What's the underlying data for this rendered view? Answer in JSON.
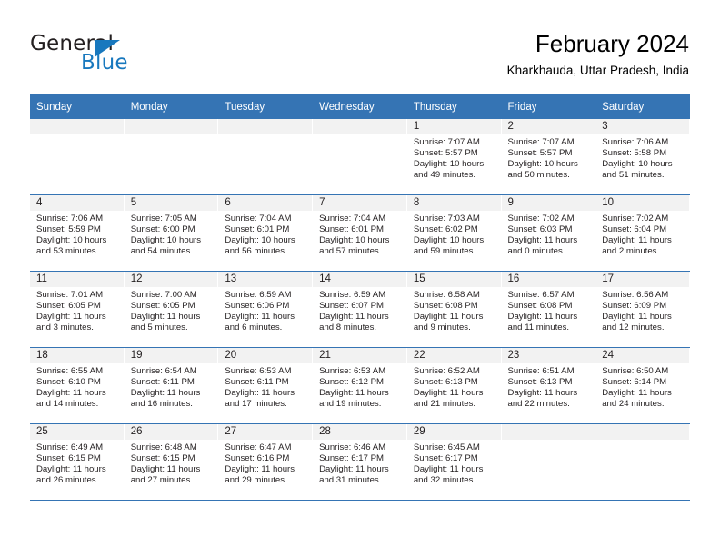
{
  "brand": {
    "name_part1": "General",
    "name_part2": "Blue",
    "logo_icon": "blue-triangle",
    "accent_color": "#1878be",
    "header_color": "#3574b4"
  },
  "header": {
    "title": "February 2024",
    "subtitle": "Kharkhauda, Uttar Pradesh, India"
  },
  "calendar": {
    "weekday_headers": [
      "Sunday",
      "Monday",
      "Tuesday",
      "Wednesday",
      "Thursday",
      "Friday",
      "Saturday"
    ],
    "labels": {
      "sunrise": "Sunrise:",
      "sunset": "Sunset:",
      "daylight": "Daylight:"
    },
    "weeks": [
      [
        {
          "day": ""
        },
        {
          "day": ""
        },
        {
          "day": ""
        },
        {
          "day": ""
        },
        {
          "day": "1",
          "sunrise": "Sunrise: 7:07 AM",
          "sunset": "Sunset: 5:57 PM",
          "daylight_line1": "Daylight: 10 hours",
          "daylight_line2": "and 49 minutes."
        },
        {
          "day": "2",
          "sunrise": "Sunrise: 7:07 AM",
          "sunset": "Sunset: 5:57 PM",
          "daylight_line1": "Daylight: 10 hours",
          "daylight_line2": "and 50 minutes."
        },
        {
          "day": "3",
          "sunrise": "Sunrise: 7:06 AM",
          "sunset": "Sunset: 5:58 PM",
          "daylight_line1": "Daylight: 10 hours",
          "daylight_line2": "and 51 minutes."
        }
      ],
      [
        {
          "day": "4",
          "sunrise": "Sunrise: 7:06 AM",
          "sunset": "Sunset: 5:59 PM",
          "daylight_line1": "Daylight: 10 hours",
          "daylight_line2": "and 53 minutes."
        },
        {
          "day": "5",
          "sunrise": "Sunrise: 7:05 AM",
          "sunset": "Sunset: 6:00 PM",
          "daylight_line1": "Daylight: 10 hours",
          "daylight_line2": "and 54 minutes."
        },
        {
          "day": "6",
          "sunrise": "Sunrise: 7:04 AM",
          "sunset": "Sunset: 6:01 PM",
          "daylight_line1": "Daylight: 10 hours",
          "daylight_line2": "and 56 minutes."
        },
        {
          "day": "7",
          "sunrise": "Sunrise: 7:04 AM",
          "sunset": "Sunset: 6:01 PM",
          "daylight_line1": "Daylight: 10 hours",
          "daylight_line2": "and 57 minutes."
        },
        {
          "day": "8",
          "sunrise": "Sunrise: 7:03 AM",
          "sunset": "Sunset: 6:02 PM",
          "daylight_line1": "Daylight: 10 hours",
          "daylight_line2": "and 59 minutes."
        },
        {
          "day": "9",
          "sunrise": "Sunrise: 7:02 AM",
          "sunset": "Sunset: 6:03 PM",
          "daylight_line1": "Daylight: 11 hours",
          "daylight_line2": "and 0 minutes."
        },
        {
          "day": "10",
          "sunrise": "Sunrise: 7:02 AM",
          "sunset": "Sunset: 6:04 PM",
          "daylight_line1": "Daylight: 11 hours",
          "daylight_line2": "and 2 minutes."
        }
      ],
      [
        {
          "day": "11",
          "sunrise": "Sunrise: 7:01 AM",
          "sunset": "Sunset: 6:05 PM",
          "daylight_line1": "Daylight: 11 hours",
          "daylight_line2": "and 3 minutes."
        },
        {
          "day": "12",
          "sunrise": "Sunrise: 7:00 AM",
          "sunset": "Sunset: 6:05 PM",
          "daylight_line1": "Daylight: 11 hours",
          "daylight_line2": "and 5 minutes."
        },
        {
          "day": "13",
          "sunrise": "Sunrise: 6:59 AM",
          "sunset": "Sunset: 6:06 PM",
          "daylight_line1": "Daylight: 11 hours",
          "daylight_line2": "and 6 minutes."
        },
        {
          "day": "14",
          "sunrise": "Sunrise: 6:59 AM",
          "sunset": "Sunset: 6:07 PM",
          "daylight_line1": "Daylight: 11 hours",
          "daylight_line2": "and 8 minutes."
        },
        {
          "day": "15",
          "sunrise": "Sunrise: 6:58 AM",
          "sunset": "Sunset: 6:08 PM",
          "daylight_line1": "Daylight: 11 hours",
          "daylight_line2": "and 9 minutes."
        },
        {
          "day": "16",
          "sunrise": "Sunrise: 6:57 AM",
          "sunset": "Sunset: 6:08 PM",
          "daylight_line1": "Daylight: 11 hours",
          "daylight_line2": "and 11 minutes."
        },
        {
          "day": "17",
          "sunrise": "Sunrise: 6:56 AM",
          "sunset": "Sunset: 6:09 PM",
          "daylight_line1": "Daylight: 11 hours",
          "daylight_line2": "and 12 minutes."
        }
      ],
      [
        {
          "day": "18",
          "sunrise": "Sunrise: 6:55 AM",
          "sunset": "Sunset: 6:10 PM",
          "daylight_line1": "Daylight: 11 hours",
          "daylight_line2": "and 14 minutes."
        },
        {
          "day": "19",
          "sunrise": "Sunrise: 6:54 AM",
          "sunset": "Sunset: 6:11 PM",
          "daylight_line1": "Daylight: 11 hours",
          "daylight_line2": "and 16 minutes."
        },
        {
          "day": "20",
          "sunrise": "Sunrise: 6:53 AM",
          "sunset": "Sunset: 6:11 PM",
          "daylight_line1": "Daylight: 11 hours",
          "daylight_line2": "and 17 minutes."
        },
        {
          "day": "21",
          "sunrise": "Sunrise: 6:53 AM",
          "sunset": "Sunset: 6:12 PM",
          "daylight_line1": "Daylight: 11 hours",
          "daylight_line2": "and 19 minutes."
        },
        {
          "day": "22",
          "sunrise": "Sunrise: 6:52 AM",
          "sunset": "Sunset: 6:13 PM",
          "daylight_line1": "Daylight: 11 hours",
          "daylight_line2": "and 21 minutes."
        },
        {
          "day": "23",
          "sunrise": "Sunrise: 6:51 AM",
          "sunset": "Sunset: 6:13 PM",
          "daylight_line1": "Daylight: 11 hours",
          "daylight_line2": "and 22 minutes."
        },
        {
          "day": "24",
          "sunrise": "Sunrise: 6:50 AM",
          "sunset": "Sunset: 6:14 PM",
          "daylight_line1": "Daylight: 11 hours",
          "daylight_line2": "and 24 minutes."
        }
      ],
      [
        {
          "day": "25",
          "sunrise": "Sunrise: 6:49 AM",
          "sunset": "Sunset: 6:15 PM",
          "daylight_line1": "Daylight: 11 hours",
          "daylight_line2": "and 26 minutes."
        },
        {
          "day": "26",
          "sunrise": "Sunrise: 6:48 AM",
          "sunset": "Sunset: 6:15 PM",
          "daylight_line1": "Daylight: 11 hours",
          "daylight_line2": "and 27 minutes."
        },
        {
          "day": "27",
          "sunrise": "Sunrise: 6:47 AM",
          "sunset": "Sunset: 6:16 PM",
          "daylight_line1": "Daylight: 11 hours",
          "daylight_line2": "and 29 minutes."
        },
        {
          "day": "28",
          "sunrise": "Sunrise: 6:46 AM",
          "sunset": "Sunset: 6:17 PM",
          "daylight_line1": "Daylight: 11 hours",
          "daylight_line2": "and 31 minutes."
        },
        {
          "day": "29",
          "sunrise": "Sunrise: 6:45 AM",
          "sunset": "Sunset: 6:17 PM",
          "daylight_line1": "Daylight: 11 hours",
          "daylight_line2": "and 32 minutes."
        },
        {
          "day": ""
        },
        {
          "day": ""
        }
      ]
    ]
  }
}
